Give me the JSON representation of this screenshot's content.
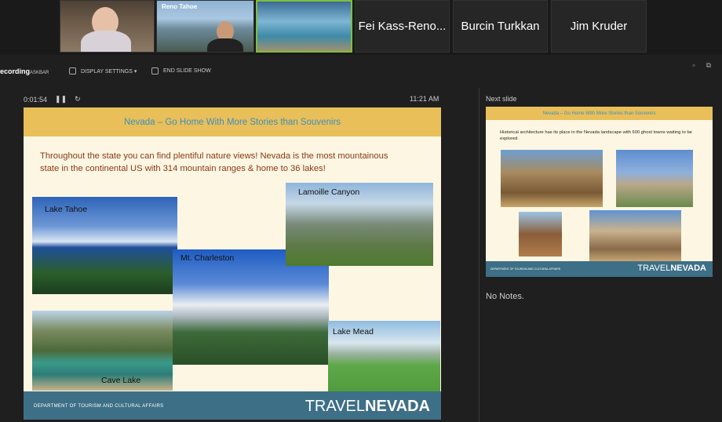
{
  "participants": {
    "video_tiles": [
      "presenter-video-woman",
      "reno-tahoe-video-man",
      "lake-tahoe-video"
    ],
    "reno_logo": "Reno Tahoe",
    "names": [
      "Fei Kass-Reno...",
      "Burcin Turkkan",
      "Jim Kruder"
    ]
  },
  "toolbar": {
    "recording_label": "ecording",
    "recording_sub": "ASKBAR",
    "display_settings": "DISPLAY SETTINGS ▾",
    "end_slide_show": "END SLIDE SHOW"
  },
  "presenter": {
    "elapsed": "0:01:54",
    "clock": "11:21 AM",
    "next_label": "Next slide",
    "notes": "No Notes."
  },
  "slide": {
    "title": "Nevada – Go Home With More Stories than Souvenirs",
    "body": "Throughout the state you can find plentiful nature views! Nevada is the most mountainous state in the continental US with 314 mountain ranges & home to 36 lakes!",
    "photos": {
      "tahoe": "Lake Tahoe",
      "charleston": "Mt. Charleston",
      "lamoille": "Lamoille Canyon",
      "cave_lake": "Cave Lake",
      "lake_mead": "Lake Mead"
    },
    "footer_dept": "DEPARTMENT OF TOURISM AND CULTURAL AFFAIRS",
    "brand_a": "TRAVEL",
    "brand_b": "NEVADA"
  },
  "next_slide": {
    "title": "Nevada – Go Home With More Stories than Souvenirs",
    "body": "Historical architecture has its place in the Nevada landscape with 600 ghost towns waiting to be explored.",
    "footer_dept": "DEPARTMENT OF TOURISM AND CULTURAL AFFAIRS",
    "brand_a": "TRAVEL",
    "brand_b": "NEVADA"
  },
  "colors": {
    "title_band": "#e8bf59",
    "title_text": "#3f8fbf",
    "body_text": "#8a3a14",
    "footer": "#3d6f86"
  }
}
